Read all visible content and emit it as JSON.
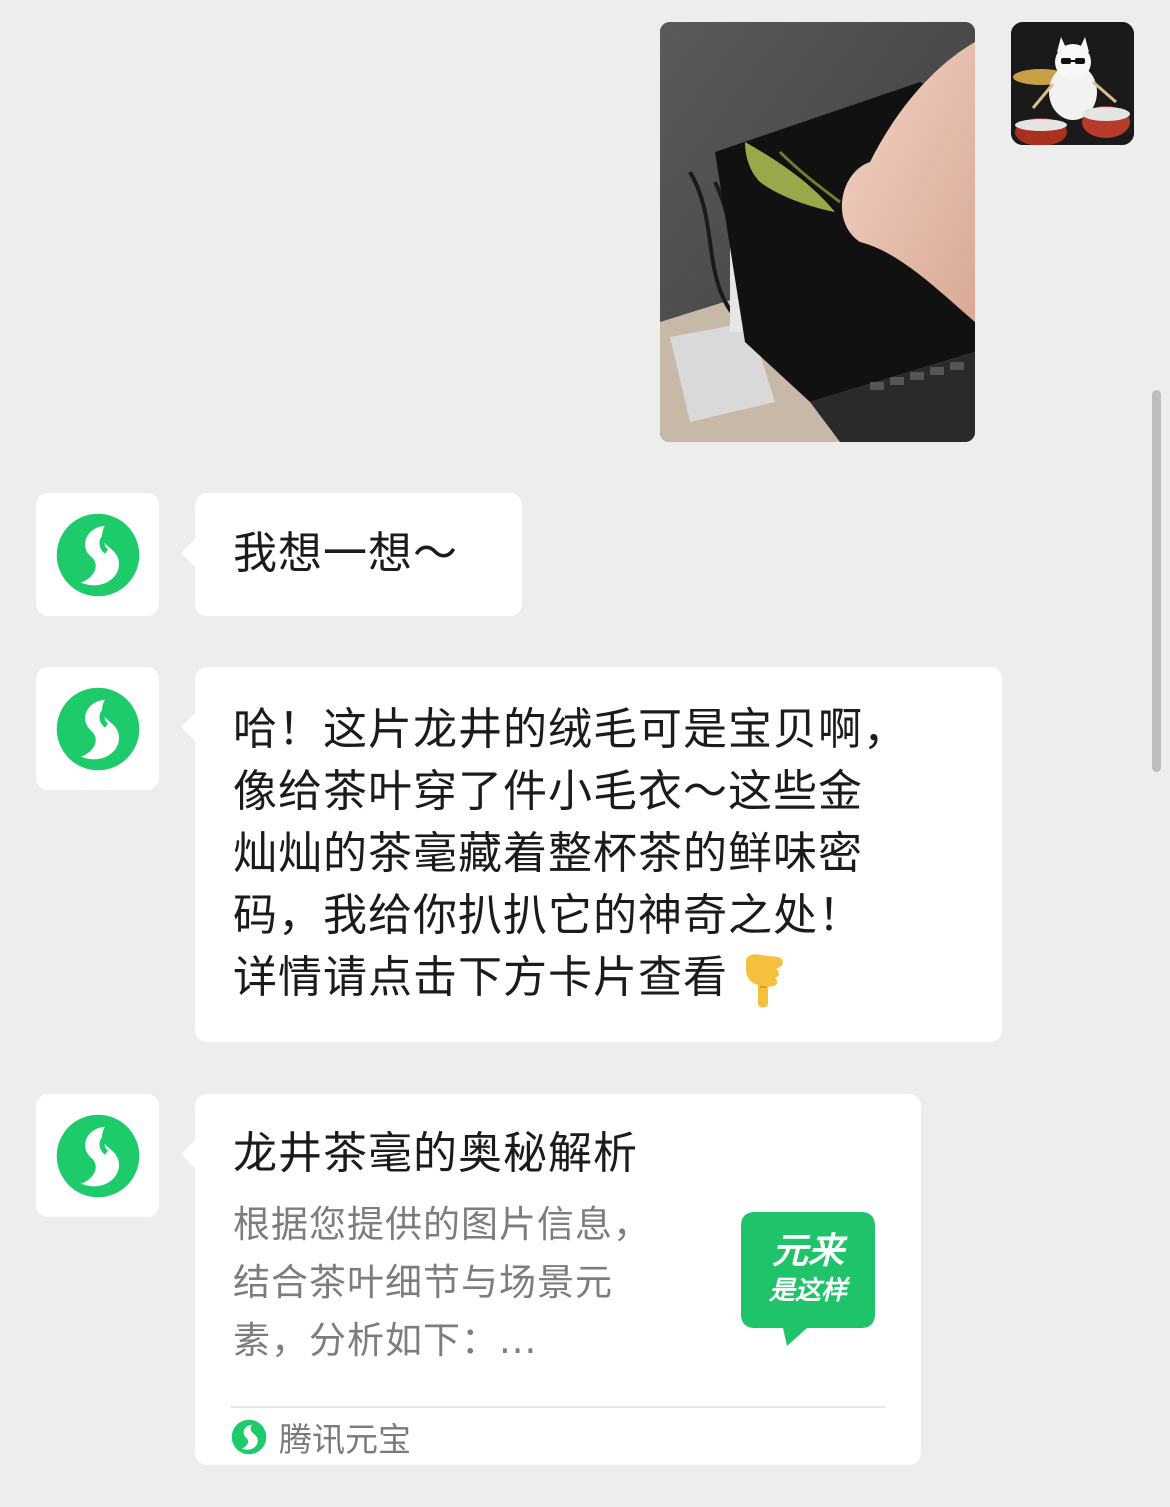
{
  "conversation": {
    "bot_messages": [
      {
        "lines": [
          "我想一想～"
        ]
      },
      {
        "lines": [
          "哈！这片龙井的绒毛可是宝贝啊，",
          "像给茶叶穿了件小毛衣～这些金",
          "灿灿的茶毫藏着整杯茶的鲜味密",
          "码，我给你扒扒它的神奇之处！",
          "详情请点击下方卡片查看"
        ],
        "emoji": "backhand-index-pointing-down"
      }
    ],
    "card": {
      "title": "龙井茶毫的奥秘解析",
      "description_lines": [
        "根据您提供的图片信息，",
        "结合茶叶细节与场景元",
        "素，分析如下：..."
      ],
      "thumbnail_text": [
        "元来",
        "是这样"
      ],
      "source": "腾讯元宝"
    }
  },
  "icons": {
    "bot_avatar": "yuanbao-logo-icon",
    "user_avatar": "cat-drummer-avatar",
    "pointing": "pointing-down-emoji"
  },
  "colors": {
    "background": "#ededed",
    "bubble": "#ffffff",
    "brand_green": "#1dcb6a",
    "text_primary": "#1b1b1b",
    "text_secondary": "#7d7d7d"
  }
}
